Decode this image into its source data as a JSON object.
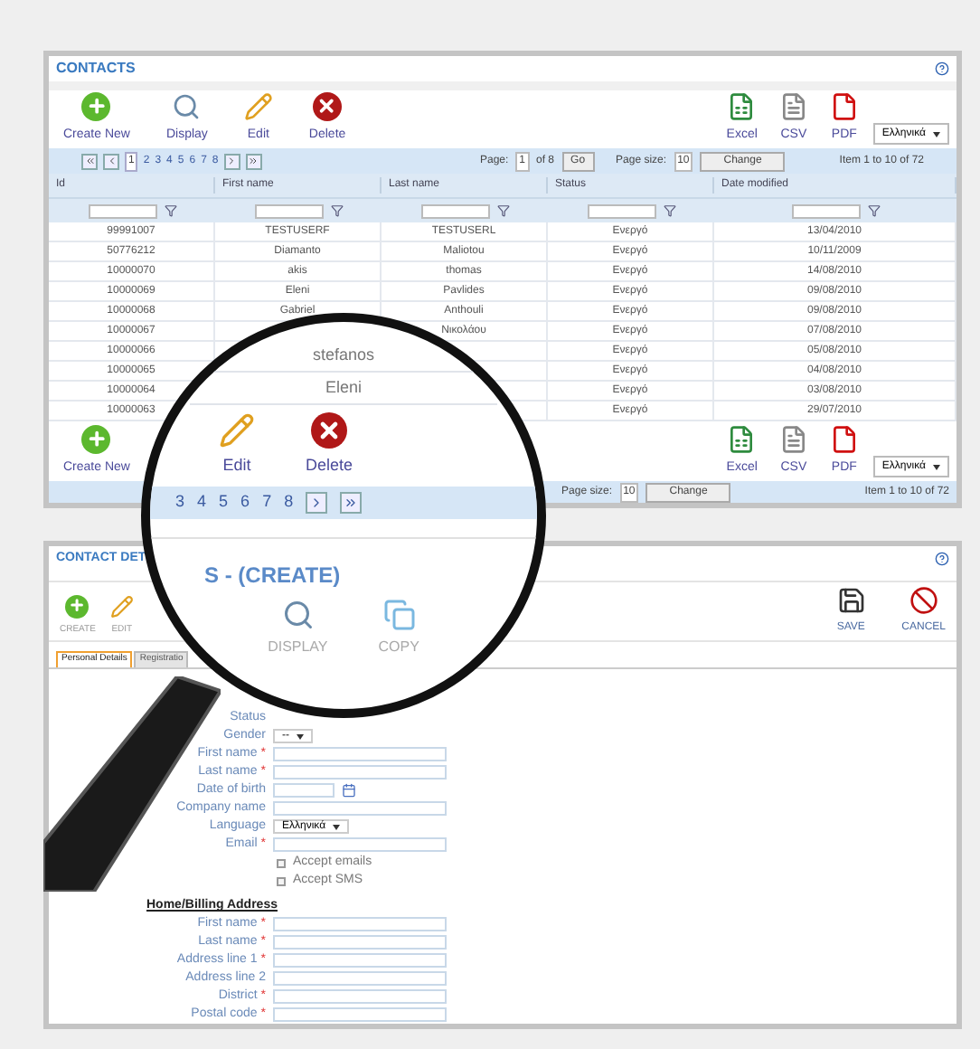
{
  "contacts": {
    "title": "CONTACTS",
    "toolbar": [
      {
        "label": "Create New",
        "kind": "create"
      },
      {
        "label": "Display",
        "kind": "display"
      },
      {
        "label": "Edit",
        "kind": "edit"
      },
      {
        "label": "Delete",
        "kind": "delete"
      }
    ],
    "exports": [
      {
        "label": "Excel",
        "kind": "excel"
      },
      {
        "label": "CSV",
        "kind": "csv"
      },
      {
        "label": "PDF",
        "kind": "pdf"
      }
    ],
    "language": "Ελληνικά",
    "pager": {
      "pages": [
        {
          "label": "1",
          "selected": true
        },
        {
          "label": "2",
          "selected": false
        },
        {
          "label": "3",
          "selected": false
        },
        {
          "label": "4",
          "selected": false
        },
        {
          "label": "5",
          "selected": false
        },
        {
          "label": "6",
          "selected": false
        },
        {
          "label": "7",
          "selected": false
        },
        {
          "label": "8",
          "selected": false
        }
      ],
      "page_label": "Page:",
      "page_value": "1",
      "of": "of 8",
      "go": "Go",
      "size_label": "Page size:",
      "size_value": "10",
      "change": "Change",
      "summary": "Item 1 to 10 of 72"
    },
    "columns": [
      "Id",
      "First name",
      "Last name",
      "Status",
      "Date modified"
    ],
    "rows": [
      {
        "id": "99991007",
        "first": "TESTUSERF",
        "last": "TESTUSERL",
        "status": "Ενεργό",
        "date": "13/04/2010"
      },
      {
        "id": "50776212",
        "first": "Diamanto",
        "last": "Maliotou",
        "status": "Ενεργό",
        "date": "10/11/2009"
      },
      {
        "id": "10000070",
        "first": "akis",
        "last": "thomas",
        "status": "Ενεργό",
        "date": "14/08/2010"
      },
      {
        "id": "10000069",
        "first": "Eleni",
        "last": "Pavlides",
        "status": "Ενεργό",
        "date": "09/08/2010"
      },
      {
        "id": "10000068",
        "first": "Gabriel",
        "last": "Anthouli",
        "status": "Ενεργό",
        "date": "09/08/2010"
      },
      {
        "id": "10000067",
        "last": "Νικολάου",
        "status": "Ενεργό",
        "date": "07/08/2010"
      },
      {
        "id": "10000066",
        "status": "Ενεργό",
        "date": "05/08/2010"
      },
      {
        "id": "10000065",
        "status": "Ενεργό",
        "date": "04/08/2010"
      },
      {
        "id": "10000064",
        "status": "Ενεργό",
        "date": "03/08/2010"
      },
      {
        "id": "10000063",
        "status": "Ενεργό",
        "date": "29/07/2010"
      }
    ],
    "bottom_toolbar": [
      {
        "label": "Create New",
        "kind": "create"
      }
    ],
    "bottom_exports": [
      {
        "label": "Excel",
        "kind": "excel"
      },
      {
        "label": "CSV",
        "kind": "csv"
      },
      {
        "label": "PDF",
        "kind": "pdf"
      }
    ],
    "bottom_language": "Ελληνικά",
    "bottom_pager": {
      "size_label": "Page size:",
      "size_value": "10",
      "change": "Change",
      "summary": "Item 1 to 10 of 72"
    }
  },
  "details": {
    "title": "CONTACT DET",
    "actions": [
      {
        "label": "CREATE",
        "kind": "create"
      },
      {
        "label": "EDIT",
        "kind": "edit"
      }
    ],
    "right_actions": [
      {
        "label": "SAVE",
        "kind": "save"
      },
      {
        "label": "CANCEL",
        "kind": "cancel"
      }
    ],
    "tabs": [
      {
        "label": "Personal Details",
        "selected": true
      },
      {
        "label": "Registratio",
        "selected": false
      }
    ],
    "fields": [
      {
        "label": "Status",
        "kind": "none"
      },
      {
        "label": "Gender",
        "kind": "select",
        "value": "--"
      },
      {
        "label": "First name",
        "kind": "text",
        "required_mark": "*"
      },
      {
        "label": "Last name",
        "kind": "text",
        "required_mark": "*"
      },
      {
        "label": "Date of birth",
        "kind": "date"
      },
      {
        "label": "Company name",
        "kind": "text"
      },
      {
        "label": "Language",
        "kind": "select",
        "value": "Ελληνικά"
      },
      {
        "label": "Email",
        "kind": "text",
        "required_mark": "*"
      }
    ],
    "checkboxes": [
      {
        "label": "Accept emails",
        "checked": false
      },
      {
        "label": "Accept SMS",
        "checked": false
      }
    ],
    "address_heading": "Home/Billing Address",
    "address_fields": [
      {
        "label": "First name",
        "required_mark": "*"
      },
      {
        "label": "Last name",
        "required_mark": "*"
      },
      {
        "label": "Address line 1",
        "required_mark": "*"
      },
      {
        "label": "Address line 2"
      },
      {
        "label": "District",
        "required_mark": "*"
      },
      {
        "label": "Postal code",
        "required_mark": "*"
      }
    ]
  },
  "magnifier": {
    "cells": [
      "stefanos",
      "Eleni"
    ],
    "actions": [
      {
        "label": "Edit",
        "kind": "edit"
      },
      {
        "label": "Delete",
        "kind": "delete"
      }
    ],
    "pages": [
      "3",
      "4",
      "5",
      "6",
      "7",
      "8"
    ],
    "title": "S - (CREATE)",
    "lower_actions": [
      {
        "label": "DISPLAY",
        "kind": "display"
      },
      {
        "label": "COPY",
        "kind": "copy"
      }
    ]
  }
}
